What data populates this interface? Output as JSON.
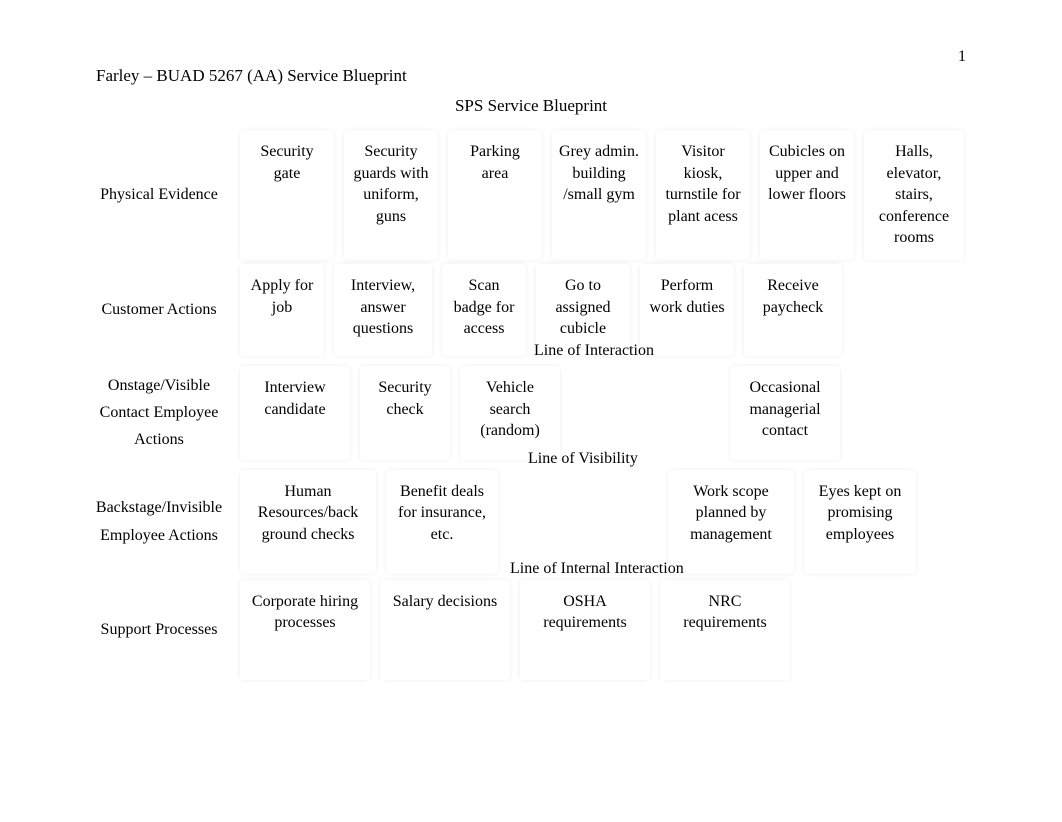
{
  "page_number": "1",
  "header": "Farley – BUAD 5267 (AA) Service Blueprint",
  "title": "SPS Service Blueprint",
  "rows": {
    "physical": {
      "label": "Physical Evidence",
      "cells": [
        "Security gate",
        "Security guards with uniform, guns",
        "Parking area",
        "Grey admin. building /small gym",
        "Visitor kiosk, turnstile for plant acess",
        "Cubicles on upper and lower floors",
        "Halls, elevator, stairs, conference rooms"
      ]
    },
    "customer": {
      "label": "Customer Actions",
      "cells": [
        "Apply for job",
        "Interview, answer questions",
        "Scan badge for access",
        "Go to assigned cubicle",
        "Perform work duties",
        "Receive paycheck"
      ]
    },
    "onstage": {
      "label": "Onstage/Visible Contact Employee Actions",
      "cells": [
        "Interview candidate",
        "Security check",
        "Vehicle search (random)",
        "Occasional managerial contact"
      ]
    },
    "backstage": {
      "label": "Backstage/Invisible Employee Actions",
      "cells": [
        "Human Resources/back ground checks",
        "Benefit deals for insurance, etc.",
        "Work scope planned by management",
        "Eyes kept on promising employees"
      ]
    },
    "support": {
      "label": "Support Processes",
      "cells": [
        "Corporate hiring processes",
        "Salary decisions",
        "OSHA requirements",
        "NRC requirements"
      ]
    }
  },
  "lines": {
    "interaction": "Line of Interaction",
    "visibility": "Line of Visibility",
    "internal": "Line of Internal Interaction"
  }
}
